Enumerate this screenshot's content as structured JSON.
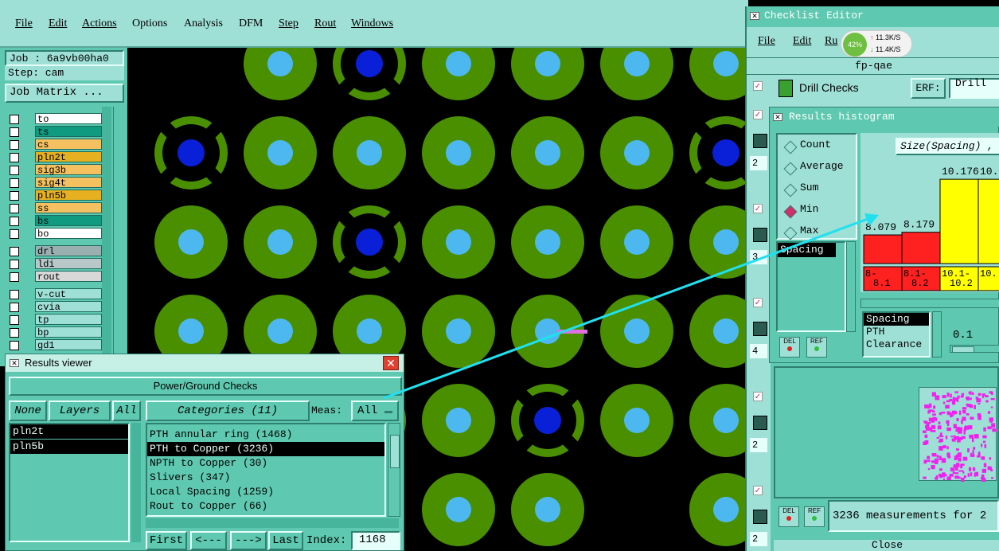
{
  "menu": {
    "items": [
      "File",
      "Edit",
      "Actions",
      "Options",
      "Analysis",
      "DFM",
      "Step",
      "Rout",
      "Windows"
    ]
  },
  "job": {
    "job_label": "Job : 6a9vb00ha0",
    "step_label": "Step: cam",
    "matrix_button": "Job Matrix ..."
  },
  "layers": [
    {
      "name": "to",
      "color": "#ffffff"
    },
    {
      "name": "ts",
      "color": "#109a80"
    },
    {
      "name": "cs",
      "color": "#f4c060"
    },
    {
      "name": "pln2t",
      "color": "#e6b020"
    },
    {
      "name": "sig3b",
      "color": "#f4c060"
    },
    {
      "name": "sig4t",
      "color": "#f4c060"
    },
    {
      "name": "pln5b",
      "color": "#e6b020"
    },
    {
      "name": "ss",
      "color": "#f4c060"
    },
    {
      "name": "bs",
      "color": "#109a80"
    },
    {
      "name": "bo",
      "color": "#ffffff"
    },
    {
      "name": "drl",
      "color": "#9ab0b0"
    },
    {
      "name": "ldi",
      "color": "#b8c8c8"
    },
    {
      "name": "rout",
      "color": "#d8d8d8"
    },
    {
      "name": "v-cut",
      "color": "#9fe0d6"
    },
    {
      "name": "cvia",
      "color": "#9fe0d6"
    },
    {
      "name": "tp",
      "color": "#9fe0d6"
    },
    {
      "name": "bp",
      "color": "#9fe0d6"
    },
    {
      "name": "gd1",
      "color": "#9fe0d6"
    }
  ],
  "results_viewer": {
    "title": "Results viewer",
    "check_name": "Power/Ground Checks",
    "none_btn": "None",
    "layers_btn": "Layers",
    "all_btn": "All",
    "categories_btn": "Categories (11)",
    "meas_label": "Meas:",
    "meas_value": "All",
    "layer_list": [
      "pln2t",
      "pln5b"
    ],
    "categories": [
      "PTH annular ring (1468)",
      "PTH to Copper (3236)",
      "NPTH to Copper (30)",
      "Slivers (347)",
      "Local Spacing (1259)",
      "Rout to Copper (66)"
    ],
    "selected_category": 1,
    "first_btn": "First",
    "prev_btn": "<---",
    "next_btn": "--->",
    "last_btn": "Last",
    "index_label": "Index:",
    "index_value": "1168"
  },
  "checklist_editor": {
    "title": "Checklist Editor",
    "menu": [
      "File",
      "Edit",
      "Ru"
    ],
    "net_meter": {
      "percent": "42%",
      "up": "11.3K/S",
      "down": "11.4K/S"
    },
    "checklist_name": "fp-qae",
    "check_name": "Drill Checks",
    "erf_label": "ERF:",
    "erf_value": "Drill",
    "row_numbers": [
      "2",
      "3",
      "4",
      "2",
      "2"
    ],
    "status": "3236 measurements for 2",
    "close_label": "Close"
  },
  "histogram": {
    "title": "Results histogram",
    "modes": [
      "Count",
      "Average",
      "Sum",
      "Min",
      "Max"
    ],
    "selected_mode": "Min",
    "measure_list": [
      "Spacing"
    ],
    "chart_title": "Size(Spacing) ,",
    "meas_list": [
      "Spacing",
      "PTH",
      "Clearance"
    ],
    "threshold": "0.1",
    "del_label": "DEL",
    "ref_label": "REF"
  },
  "chart_data": {
    "type": "bar",
    "categories": [
      "8-\n8.1",
      "8.1-\n8.2",
      "10.1-\n10.2",
      "10."
    ],
    "bar_labels": [
      "8.079",
      "8.179",
      "10.176",
      "10."
    ],
    "range_labels": [
      [
        "8-",
        "8.1"
      ],
      [
        "8.1-",
        "8.2"
      ],
      [
        "10.1-",
        "10.2"
      ],
      [
        "10.",
        ""
      ]
    ],
    "values": [
      8.079,
      8.179,
      10.176,
      10.176
    ],
    "colors": [
      "#ff2020",
      "#ff2020",
      "#ffff00",
      "#ffff00"
    ]
  },
  "colors": {
    "teal": "#9fe0d6",
    "teal_dark": "#5ec9b0",
    "pad_green": "#4a8f00",
    "pad_hole": "#4db8f0",
    "via_blue": "#0a1fd8"
  }
}
